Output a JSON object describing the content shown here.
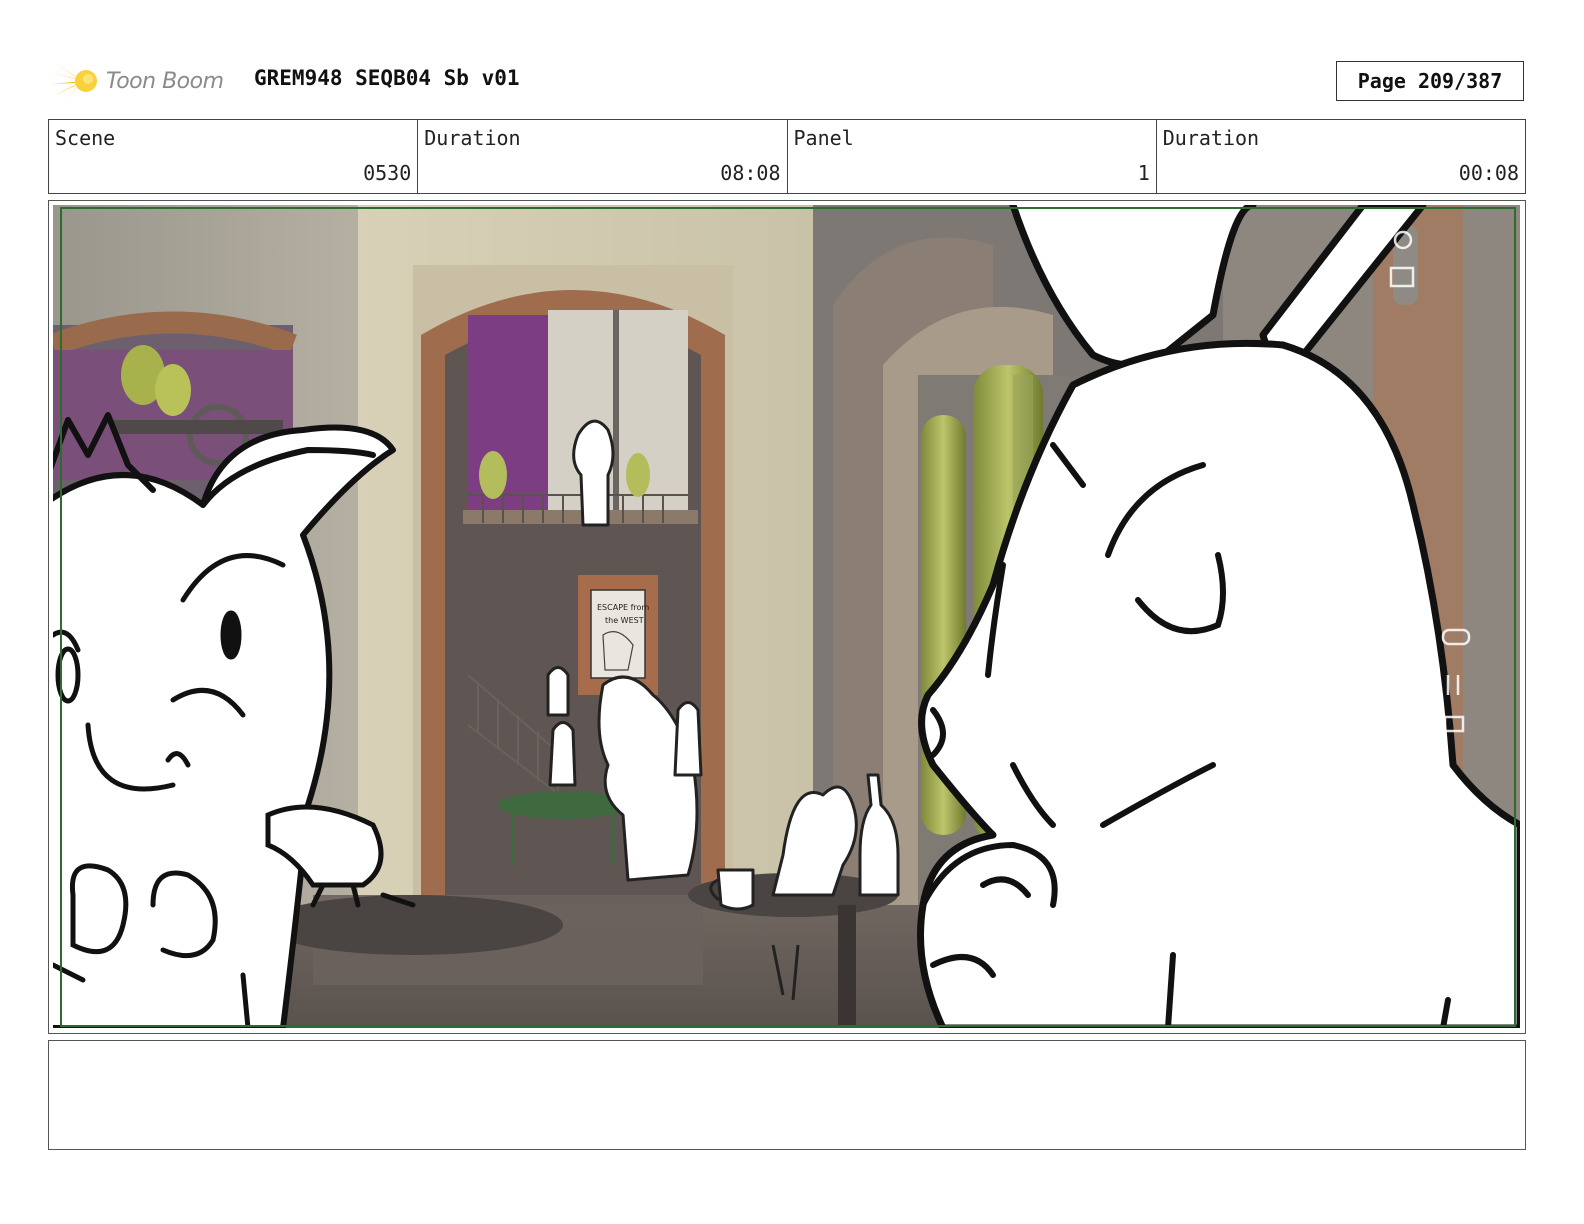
{
  "header": {
    "logo_text": "Toon Boom",
    "doc_title": "GREM948 SEQB04 Sb v01",
    "page_label": "Page 209/387"
  },
  "info": {
    "scene_label": "Scene",
    "scene_value": "0530",
    "duration1_label": "Duration",
    "duration1_value": "08:08",
    "panel_label": "Panel",
    "panel_value": "1",
    "duration2_label": "Duration",
    "duration2_value": "00:08"
  },
  "panel": {
    "poster_line1": "ESCAPE from",
    "poster_line2": "the WEST"
  },
  "colors": {
    "safe_frame": "#2e6b2e",
    "logo_accent": "#f2c21b"
  }
}
